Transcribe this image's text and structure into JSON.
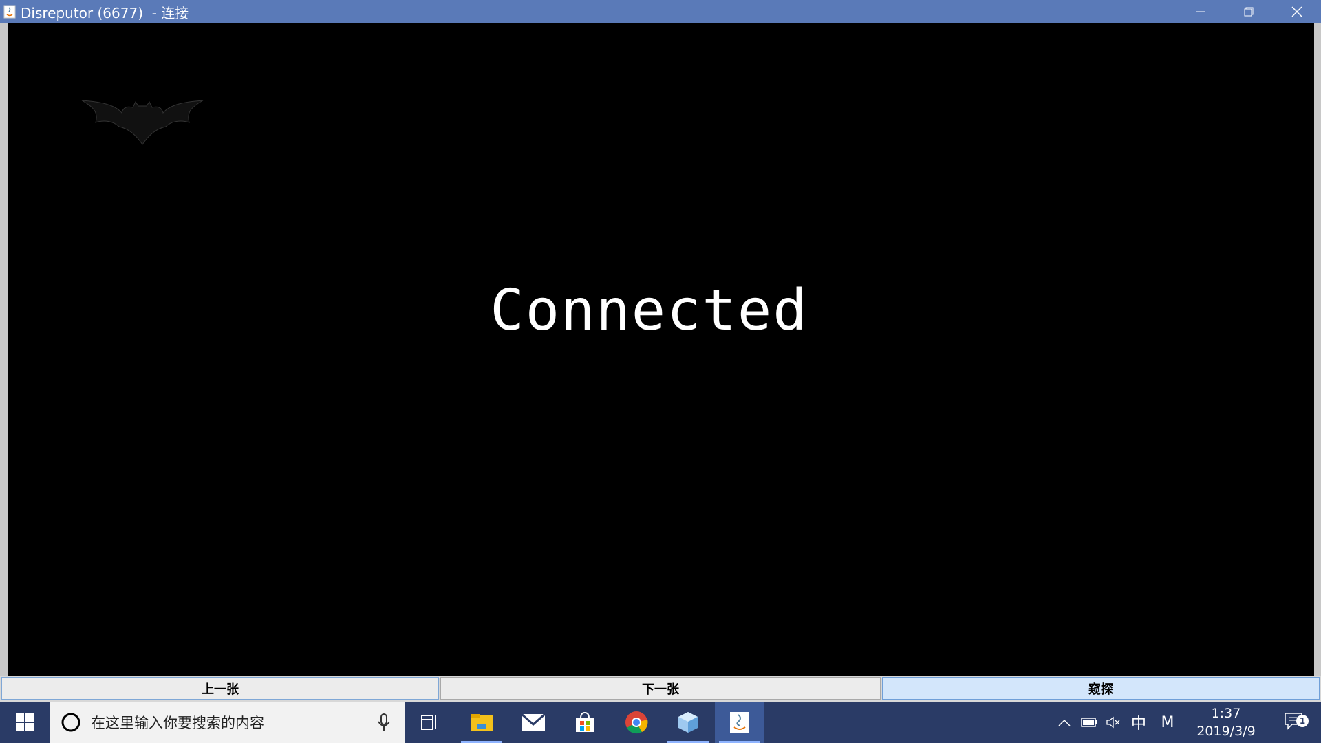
{
  "window": {
    "title": "Disreputor (6677)  - 连接",
    "minimize_icon": "minimize-icon",
    "maximize_icon": "restore-icon",
    "close_icon": "close-icon"
  },
  "canvas": {
    "logo": "bat-logo",
    "status": "Connected"
  },
  "buttons": {
    "prev_label": "上一张",
    "next_label": "下一张",
    "peek_label": "窥探"
  },
  "taskbar": {
    "search_placeholder": "在这里输入你要搜索的内容",
    "apps": [
      "task-view-icon",
      "file-explorer-icon",
      "mail-icon",
      "store-icon",
      "chrome-icon",
      "3d-box-icon",
      "java-icon"
    ],
    "tray": {
      "ime": "中",
      "ime_mode": "M",
      "time": "1:37",
      "date": "2019/3/9",
      "notification_count": "1"
    }
  },
  "colors": {
    "titlebar": "#5a7ab8",
    "taskbar": "#2a3b66",
    "peek_button": "#d3e6fb"
  }
}
